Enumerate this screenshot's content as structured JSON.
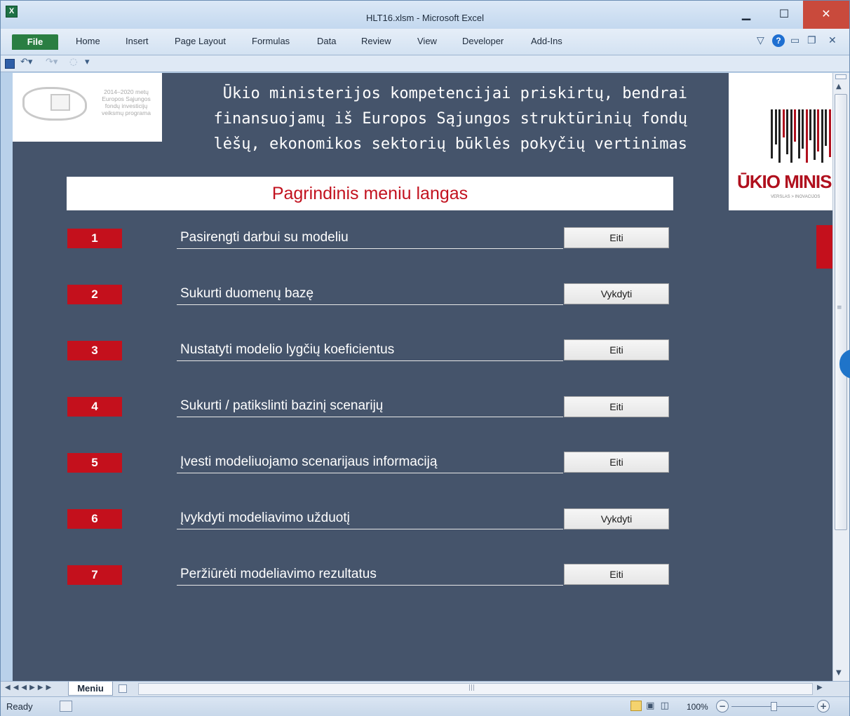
{
  "window": {
    "title": "HLT16.xlsm  -  Microsoft Excel",
    "minimize": "▁",
    "maximize": "☐",
    "close": "✕",
    "app_icon": "X"
  },
  "ribbon": {
    "tabs": [
      "File",
      "Home",
      "Insert",
      "Page Layout",
      "Formulas",
      "Data",
      "Review",
      "View",
      "Developer",
      "Add-Ins"
    ],
    "help": "?"
  },
  "logo_left": {
    "lines": [
      "2014–2020 metų",
      "Europos Sąjungos",
      "fondų investicijų",
      "veiksmų programa"
    ]
  },
  "logo_right": {
    "text": "ŪKIO MINIS",
    "subtext": "VERSLAS > INOVACIJOS"
  },
  "heading": {
    "lines": [
      "Ūkio ministerijos kompetencijai priskirtų, bendrai",
      "finansuojamų iš Europos Sąjungos struktūrinių fondų",
      "lėšų, ekonomikos sektorių būklės pokyčių vertinimas"
    ]
  },
  "menu": {
    "title": "Pagrindinis meniu langas",
    "rows": [
      {
        "number": "1",
        "label": "Pasirengti darbui su modeliu",
        "button": "Eiti"
      },
      {
        "number": "2",
        "label": "Sukurti duomenų bazę",
        "button": "Vykdyti"
      },
      {
        "number": "3",
        "label": "Nustatyti modelio lygčių koeficientus",
        "button": "Eiti"
      },
      {
        "number": "4",
        "label": "Sukurti / patikslinti bazinį scenarijų",
        "button": "Eiti"
      },
      {
        "number": "5",
        "label": "Įvesti modeliuojamo scenarijaus informaciją",
        "button": "Eiti"
      },
      {
        "number": "6",
        "label": "Įvykdyti modeliavimo užduotį",
        "button": "Vykdyti"
      },
      {
        "number": "7",
        "label": "Peržiūrėti modeliavimo rezultatus",
        "button": "Eiti"
      }
    ]
  },
  "sheet_tabs": {
    "nav": "◀◀◀▶▶▶",
    "active": "Meniu"
  },
  "status": {
    "ready": "Ready",
    "zoom": "100%",
    "zoom_minus": "−",
    "zoom_plus": "+"
  },
  "colors": {
    "sheet_background": "#45546b",
    "accent_red": "#c4101c",
    "title_red": "#c2121f"
  }
}
